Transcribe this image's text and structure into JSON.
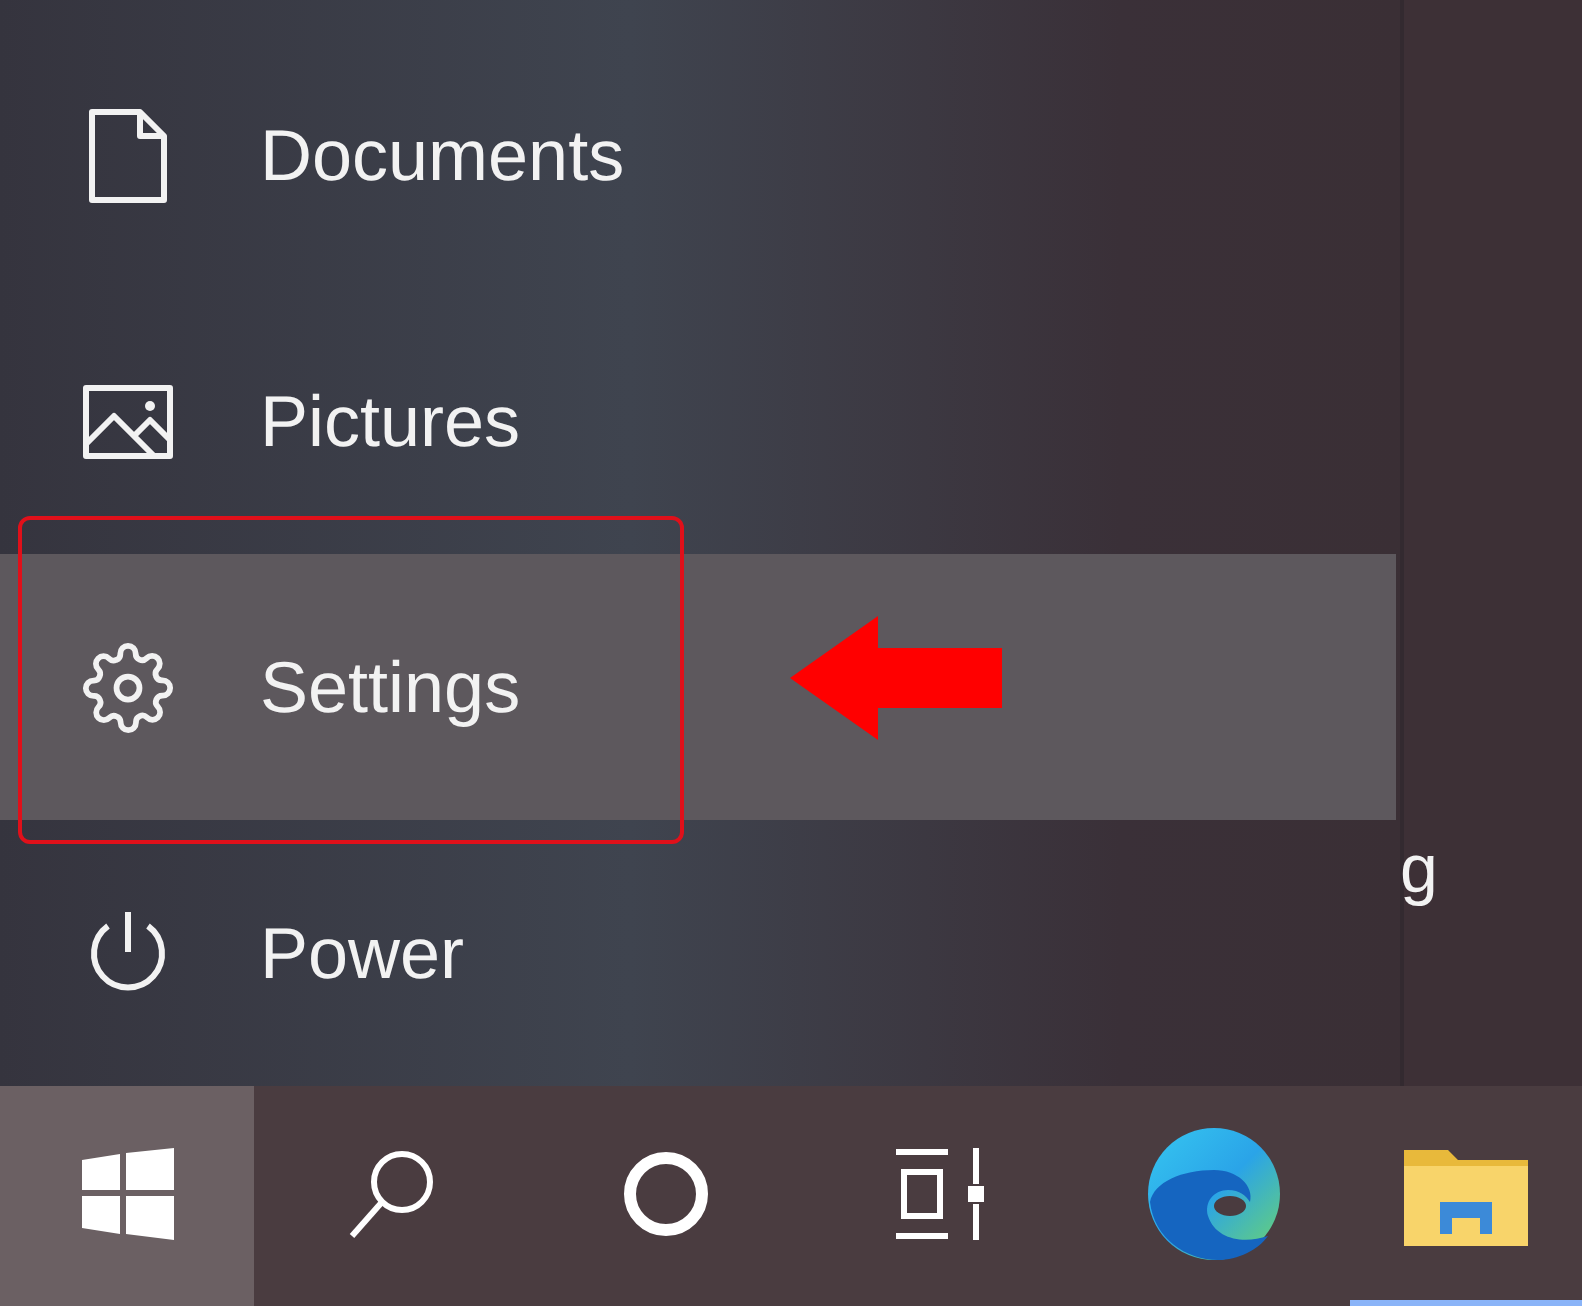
{
  "start_menu": {
    "items": [
      {
        "kind": "document",
        "label": "Documents",
        "selected": false
      },
      {
        "kind": "pictures",
        "label": "Pictures",
        "selected": false
      },
      {
        "kind": "settings",
        "label": "Settings",
        "selected": true
      },
      {
        "kind": "power",
        "label": "Power",
        "selected": false
      }
    ]
  },
  "tile_column": {
    "text": "g"
  },
  "taskbar": {
    "items": [
      {
        "kind": "start",
        "selected": true,
        "running": false
      },
      {
        "kind": "search",
        "selected": false,
        "running": false
      },
      {
        "kind": "cortana",
        "selected": false,
        "running": false
      },
      {
        "kind": "task_view",
        "selected": false,
        "running": false
      },
      {
        "kind": "edge",
        "selected": false,
        "running": false
      },
      {
        "kind": "explorer",
        "selected": false,
        "running": true
      }
    ]
  }
}
